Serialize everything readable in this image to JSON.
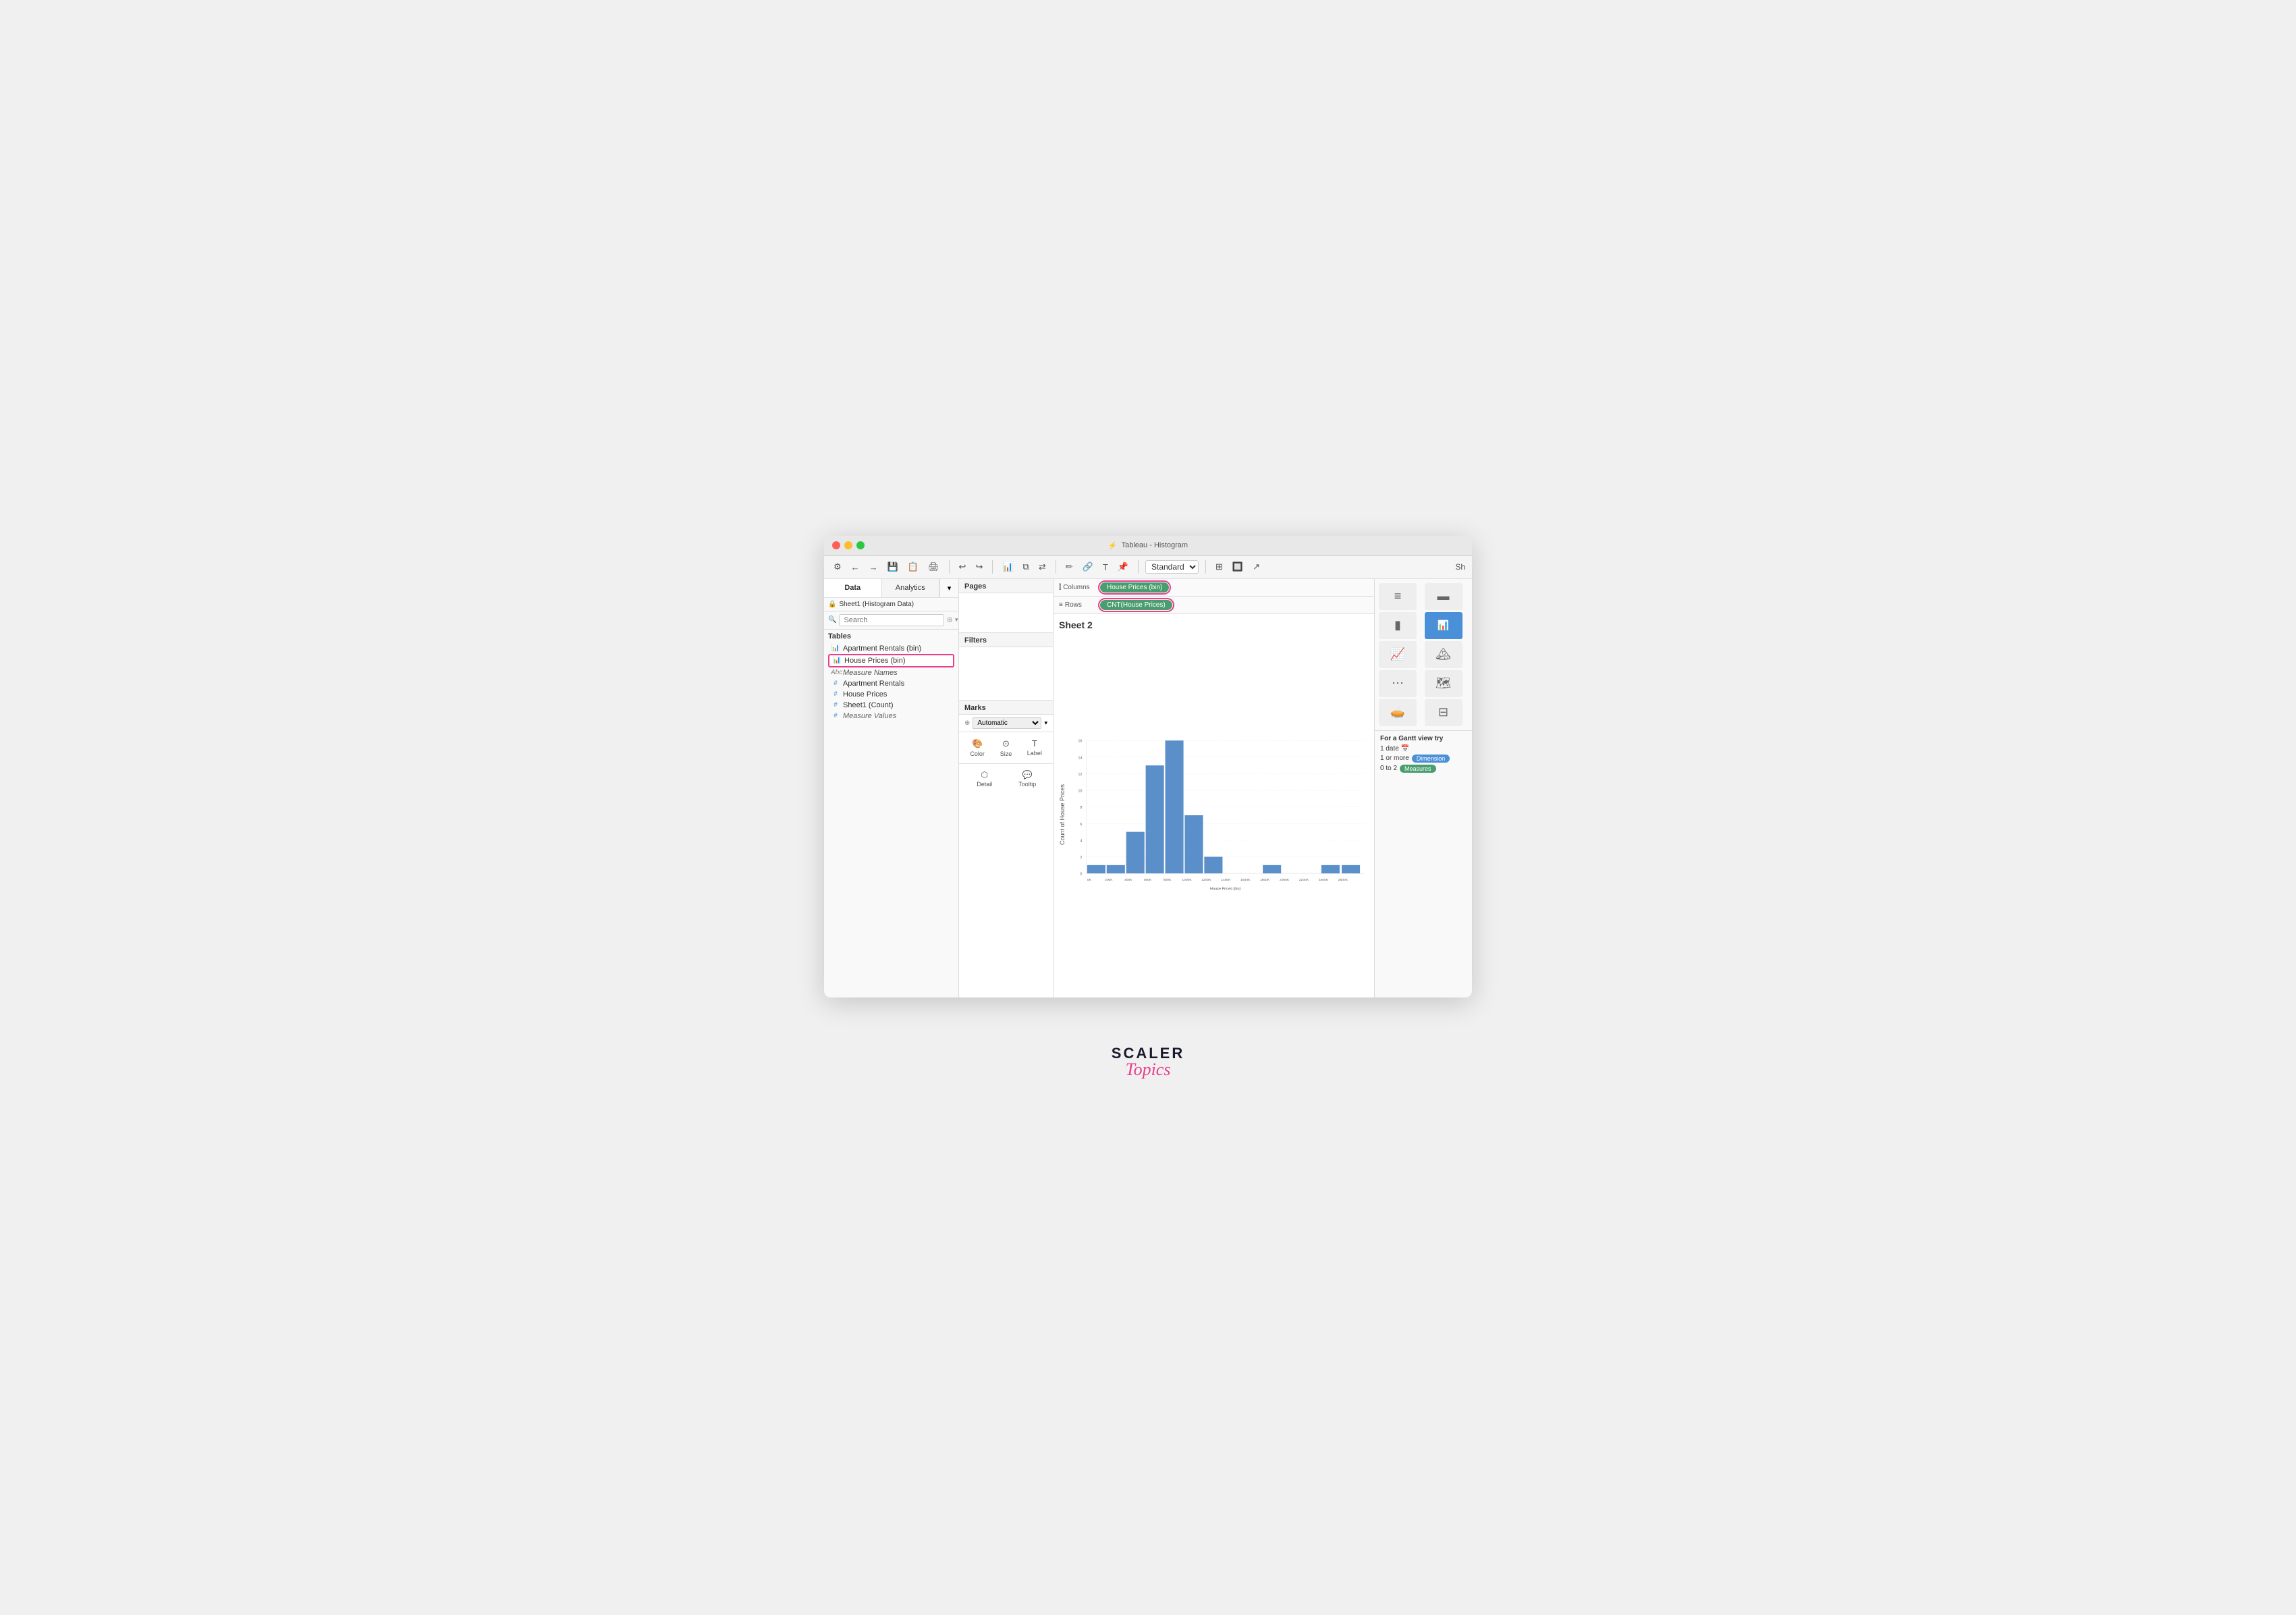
{
  "window": {
    "title": "Tableau - Histogram",
    "traffic_lights": [
      "red",
      "yellow",
      "green"
    ]
  },
  "toolbar": {
    "standard_label": "Standard",
    "show_me_label": "Sh"
  },
  "left_panel": {
    "tabs": [
      {
        "id": "data",
        "label": "Data"
      },
      {
        "id": "analytics",
        "label": "Analytics"
      }
    ],
    "workbook": "Sheet1 (Histogram Data)",
    "search_placeholder": "Search",
    "tables_label": "Tables",
    "items": [
      {
        "id": "apartment-rentals-bin",
        "icon": "bar",
        "icon_type": "blue",
        "label": "Apartment Rentals (bin)",
        "italic": false
      },
      {
        "id": "house-prices-bin",
        "icon": "bar",
        "icon_type": "blue",
        "label": "House Prices (bin)",
        "italic": false,
        "highlighted": true
      },
      {
        "id": "measure-names",
        "icon": "abc",
        "icon_type": "italic",
        "label": "Measure Names",
        "italic": true
      },
      {
        "id": "apartment-rentals",
        "icon": "#",
        "icon_type": "hash",
        "label": "Apartment Rentals",
        "italic": false
      },
      {
        "id": "house-prices",
        "icon": "#",
        "icon_type": "hash",
        "label": "House Prices",
        "italic": false
      },
      {
        "id": "sheet1-count",
        "icon": "#",
        "icon_type": "hash",
        "label": "Sheet1 (Count)",
        "italic": false
      },
      {
        "id": "measure-values",
        "icon": "#",
        "icon_type": "hash",
        "label": "Measure Values",
        "italic": true
      }
    ]
  },
  "shelves": {
    "columns_label": "Columns",
    "rows_label": "Rows",
    "columns_pill": "House Prices (bin)",
    "rows_pill": "CNT(House Prices)"
  },
  "sheet": {
    "title": "Sheet 2"
  },
  "marks": {
    "type": "Automatic",
    "buttons": [
      {
        "id": "color",
        "icon": "🎨",
        "label": "Color"
      },
      {
        "id": "size",
        "icon": "⊙",
        "label": "Size"
      },
      {
        "id": "label",
        "icon": "T",
        "label": "Label"
      },
      {
        "id": "detail",
        "icon": "⬡",
        "label": "Detail"
      },
      {
        "id": "tooltip",
        "icon": "💬",
        "label": "Tooltip"
      }
    ]
  },
  "histogram": {
    "y_label": "Count of House Prices",
    "x_label": "House Prices (bin)",
    "bars": [
      {
        "x_start": 0,
        "x_label": "0K",
        "value": 1
      },
      {
        "x_start": 1,
        "x_label": "200K",
        "value": 1
      },
      {
        "x_start": 2,
        "x_label": "400K",
        "value": 5
      },
      {
        "x_start": 3,
        "x_label": "600K",
        "value": 13
      },
      {
        "x_start": 4,
        "x_label": "800K",
        "value": 16
      },
      {
        "x_start": 5,
        "x_label": "1000K",
        "value": 7
      },
      {
        "x_start": 6,
        "x_label": "1200K",
        "value": 2
      },
      {
        "x_start": 7,
        "x_label": "1400K",
        "value": 0
      },
      {
        "x_start": 8,
        "x_label": "1600K",
        "value": 0
      },
      {
        "x_start": 9,
        "x_label": "1800K",
        "value": 1
      },
      {
        "x_start": 10,
        "x_label": "2000K",
        "value": 0
      },
      {
        "x_start": 11,
        "x_label": "2200K",
        "value": 0
      },
      {
        "x_start": 12,
        "x_label": "2400K",
        "value": 1
      },
      {
        "x_start": 13,
        "x_label": "2600K",
        "value": 0
      }
    ],
    "y_max": 16,
    "y_ticks": [
      0,
      2,
      4,
      6,
      8,
      10,
      12,
      14,
      16
    ],
    "bar_color": "#5b8fc9"
  },
  "right_panel": {
    "show_me_label": "Show Me",
    "gantt_title": "For a Gantt view try",
    "gantt_rows": [
      {
        "label": "1 date",
        "icon": "📅"
      },
      {
        "label": "1 or more",
        "pill": "Dimension",
        "pill_color": "blue"
      },
      {
        "label": "0 to 2",
        "pill": "Measures",
        "pill_color": "green"
      }
    ]
  },
  "branding": {
    "scaler": "SCALER",
    "topics": "Topics"
  }
}
